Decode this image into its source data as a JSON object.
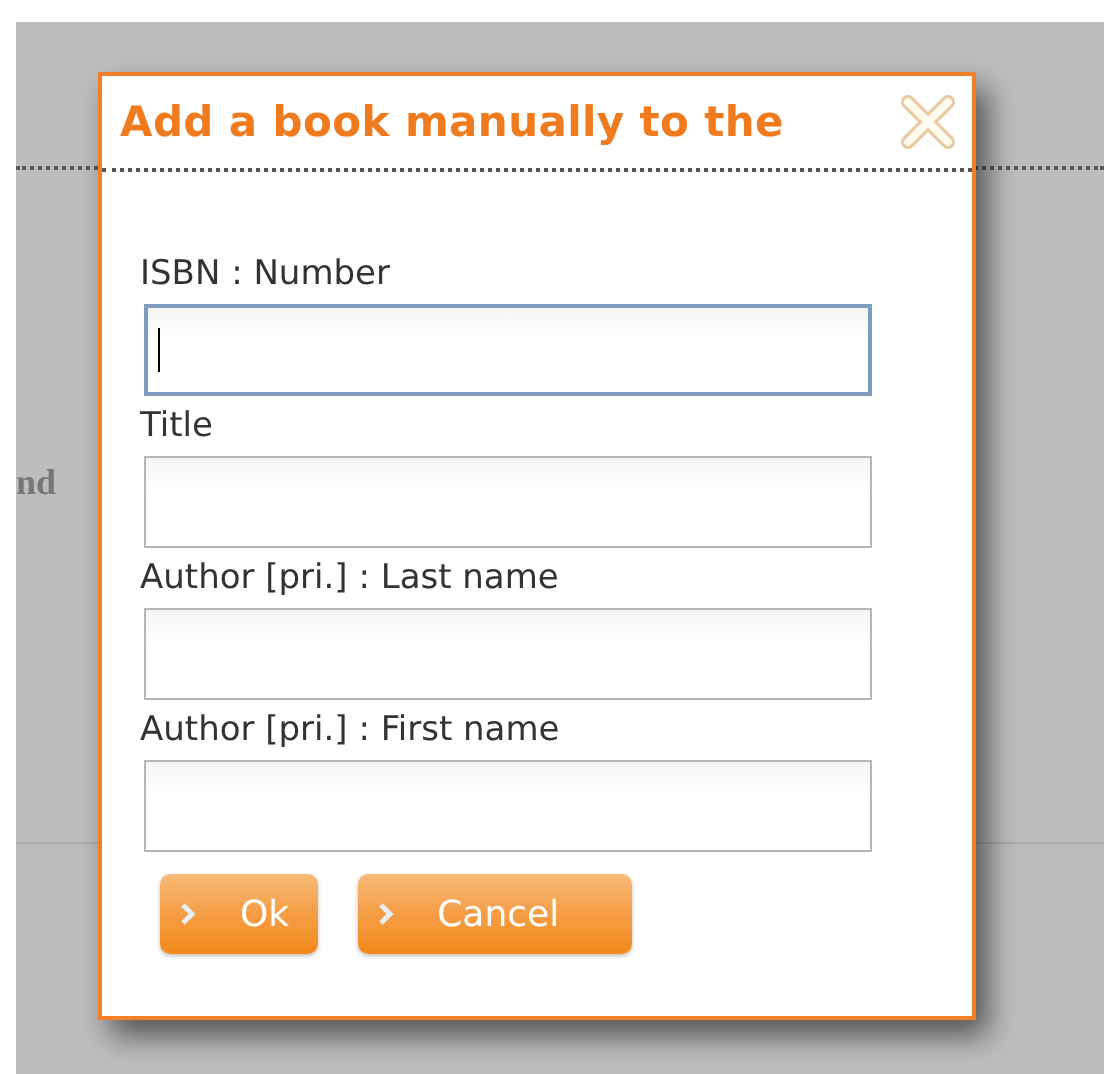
{
  "background": {
    "text": "nd"
  },
  "dialog": {
    "title": "Add a book manually to the",
    "fields": [
      {
        "label": "ISBN : Number",
        "focused": true
      },
      {
        "label": "Title",
        "focused": false
      },
      {
        "label": "Author [pri.] : Last name",
        "focused": false
      },
      {
        "label": "Author [pri.] : First name",
        "focused": false
      }
    ],
    "buttons": [
      {
        "label": "Ok"
      },
      {
        "label": "Cancel"
      }
    ]
  }
}
